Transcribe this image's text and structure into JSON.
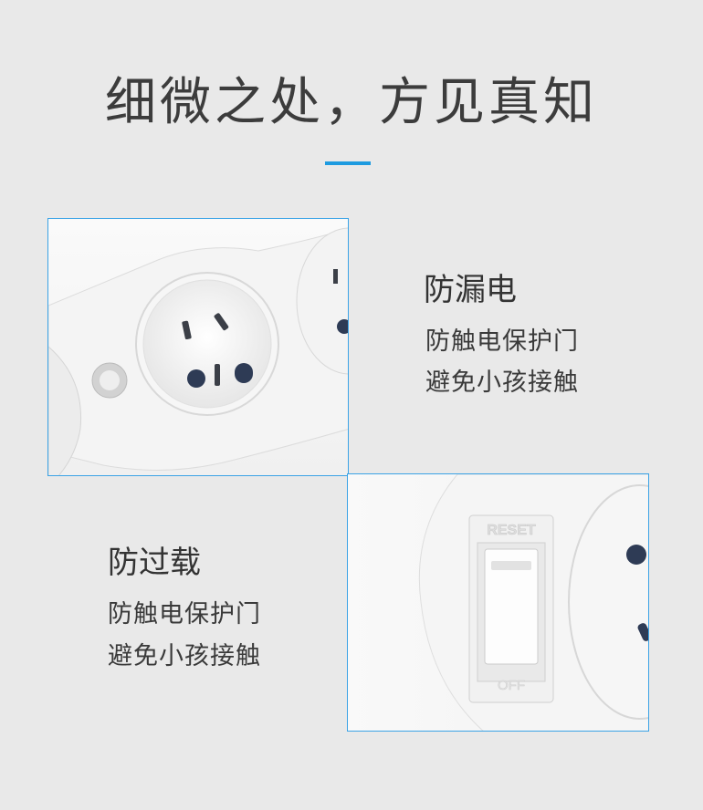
{
  "page": {
    "title": "细微之处，方见真知",
    "accent_color": "#1e9be0"
  },
  "feature_leakage": {
    "heading": "防漏电",
    "lines": [
      "防触电保护门",
      "避免小孩接触"
    ]
  },
  "feature_overload": {
    "heading": "防过载",
    "lines": [
      "防触电保护门",
      "避免小孩接触"
    ]
  },
  "switch_photo": {
    "top_text": "RESET",
    "bottom_text": "OFF"
  }
}
